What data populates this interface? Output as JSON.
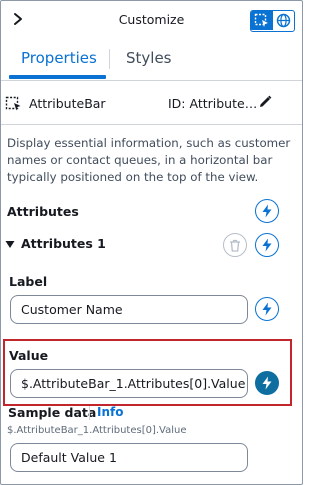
{
  "header": {
    "title": "Customize",
    "chevron_icon": "chevron-right-icon",
    "mode_icons": [
      "select-region-icon",
      "globe-icon"
    ],
    "accent_color": "#0972d3"
  },
  "tabs": [
    {
      "label": "Properties",
      "active": true
    },
    {
      "label": "Styles",
      "active": false
    }
  ],
  "component": {
    "name": "AttributeBar",
    "id_text": "ID: Attribute…",
    "icon": "dashed-box-icon",
    "edit_icon": "pencil-icon"
  },
  "description": "Display essential information, such as customer names or contact queues, in a horizontal bar typically positioned on the top of the view.",
  "attributes": {
    "section_title": "Attributes",
    "group_title": "Attributes 1",
    "label_field": {
      "label": "Label",
      "value": "Customer Name"
    },
    "value_field": {
      "label": "Value",
      "value": "$.AttributeBar_1.Attributes[0].Value"
    },
    "sample_data": {
      "label": "Sample data",
      "info_link": "Info",
      "path": "$.AttributeBar_1.Attributes[0].Value",
      "value": "Default Value 1"
    }
  },
  "colors": {
    "highlight": "#c0262c",
    "bolt_filled": "#0f6ea0"
  }
}
